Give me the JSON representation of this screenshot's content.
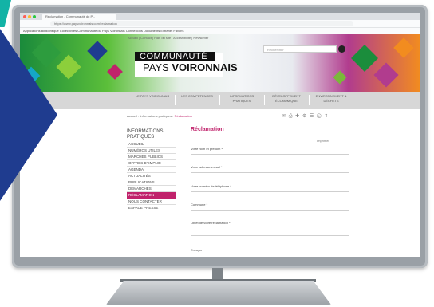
{
  "browser": {
    "tab_title": "Réclamation - Communauté du P...",
    "url": "https://www.paysvoironnais.com/reclamation",
    "bookmarks": "Applications  Bibliothèque  Collectivités  Communauté du Pays Voironnais  Connexions  Documents  Extranet  Favoris"
  },
  "banner": {
    "top_nav": "Accueil   |   Contact   |   Plan du site   |   Accessibilité   |   Newsletter",
    "title_line1": "COMMUNAUTÉ",
    "title_line2_a": "PAYS ",
    "title_line2_b": "VOIRONNAIS",
    "search_placeholder": "Rechercher"
  },
  "menu": [
    "LE PAYS VOIRONNAIS",
    "LES COMPÉTENCES",
    "INFORMATIONS PRATIQUES",
    "DÉVELOPPEMENT ÉCONOMIQUE",
    "ENVIRONNEMENT & DÉCHETS"
  ],
  "breadcrumb": {
    "path": "Accueil › Informations pratiques › ",
    "current": "Réclamation"
  },
  "tools": "✉ ⎙ ✚ ⚙ ☰ ⓘ ⬆",
  "sidebar": {
    "heading": "INFORMATIONS PRATIQUES",
    "items": [
      "ACCUEIL",
      "NUMÉROS UTILES",
      "MARCHÉS PUBLICS",
      "OFFRES D'EMPLOI",
      "AGENDA",
      "ACTUALITÉS",
      "PUBLICATIONS",
      "DÉMARCHES",
      "RÉCLAMATION",
      "NOUS CONTACTER",
      "ESPACE PRESSE"
    ],
    "active_index": 8
  },
  "form": {
    "title": "Réclamation",
    "print_label": "Imprimer",
    "fields": [
      "Votre nom et prénom *",
      "Votre adresse e-mail *",
      "Votre numéro de téléphone *",
      "Commune *",
      "Objet de votre réclamation *"
    ],
    "submit_label": "Envoyer"
  },
  "colors": {
    "accent": "#c0226b",
    "menu_bg": "#d7d7d7",
    "blue_shape": "#1f3c8f"
  }
}
